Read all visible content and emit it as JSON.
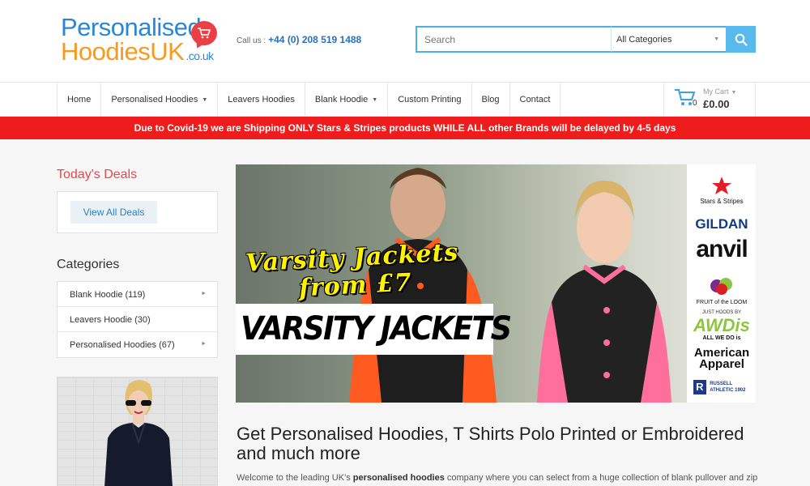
{
  "header": {
    "logo_line1": "Personalised",
    "logo_line2": "HoodiesUK",
    "logo_domain": ".co.uk",
    "call_label": "Call us :",
    "phone": "+44 (0) 208 519 1488"
  },
  "search": {
    "placeholder": "Search",
    "category": "All Categories"
  },
  "nav": {
    "items": [
      {
        "label": "Home"
      },
      {
        "label": "Personalised Hoodies"
      },
      {
        "label": "Leavers Hoodies"
      },
      {
        "label": "Blank Hoodie"
      },
      {
        "label": "Custom Printing"
      },
      {
        "label": "Blog"
      },
      {
        "label": "Contact"
      }
    ]
  },
  "cart": {
    "label": "My Cart",
    "count": "0",
    "amount": "£0.00"
  },
  "banner": "Due to Covid-19 we are Shipping ONLY Stars & Stripes products WHILE ALL other Brands will be delayed by 4-5 days",
  "sidebar": {
    "deals_title": "Today's Deals",
    "view_all": "View All Deals",
    "categories_title": "Categories",
    "categories": [
      {
        "label": "Blank Hoodie (119)"
      },
      {
        "label": "Leavers Hoodie (30)"
      },
      {
        "label": "Personalised Hoodies (67)"
      }
    ]
  },
  "hero": {
    "tagline1": "Varsity Jackets",
    "tagline2": "from £7",
    "headline": "VARSITY JACKETS",
    "brands": [
      "Stars & Stripes",
      "GILDAN",
      "anvil",
      "FRUIT of the LOOM",
      "JUST HOODS BY",
      "AWDis",
      "ALL WE DO is",
      "American Apparel",
      "RUSSELL ATHLETIC 1902"
    ]
  },
  "main": {
    "heading": "Get Personalised Hoodies, T Shirts Polo Printed or Embroidered and much more",
    "intro_start": "Welcome to the leading UK's ",
    "intro_bold": "personalised hoodies",
    "intro_end": " company where you can select from a huge collection of blank pullover and zip"
  }
}
